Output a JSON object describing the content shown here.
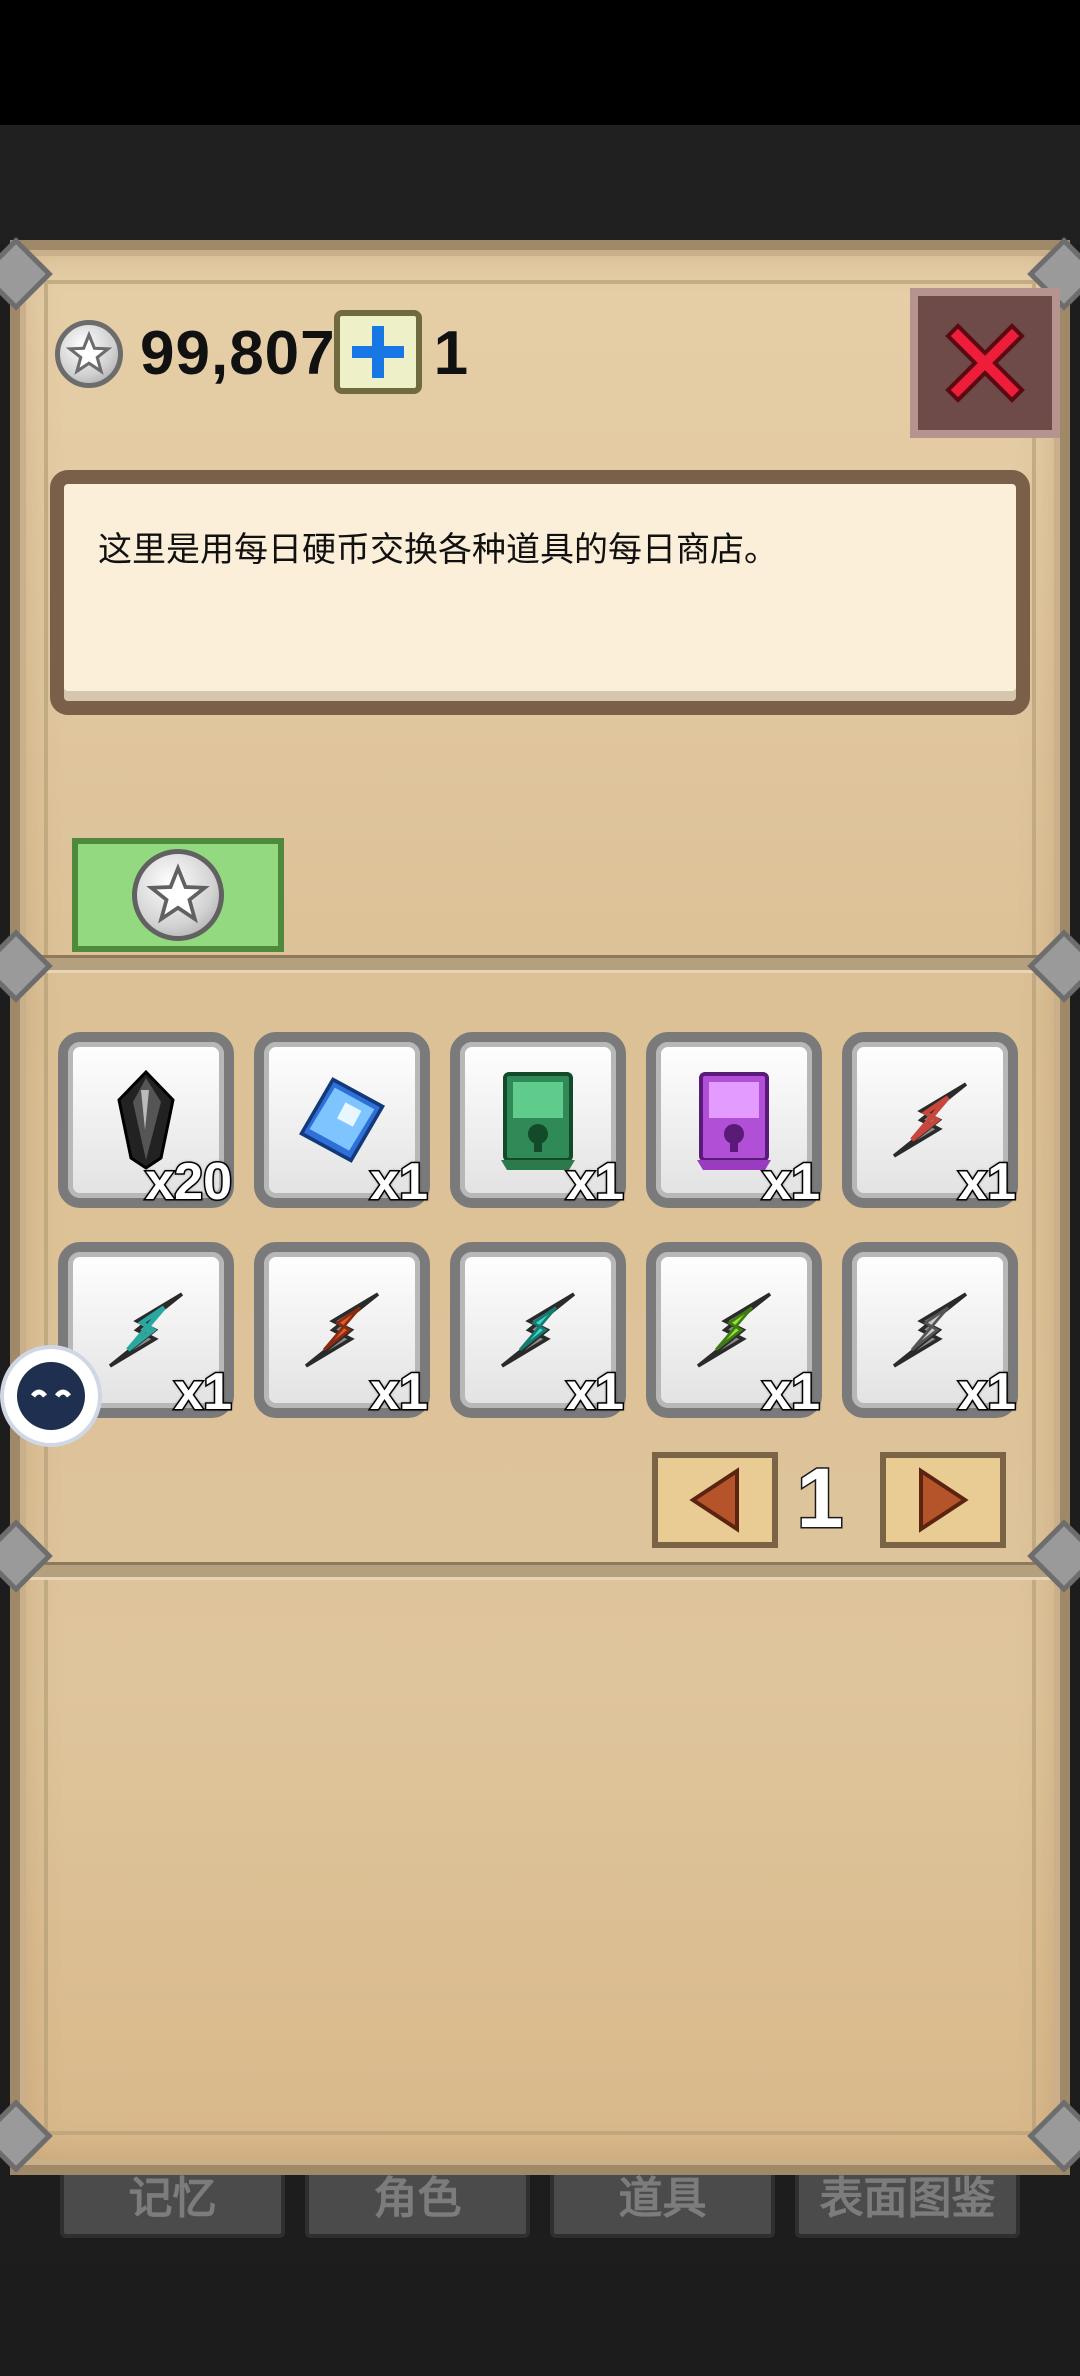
{
  "header": {
    "coin_value": "99,807",
    "coin_suffix": "1",
    "coin_icon": "star-coin-icon",
    "add_icon": "plus-icon",
    "close_icon": "close-x-icon"
  },
  "description": "这里是用每日硬币交换各种道具的每日商店。",
  "category_tab": {
    "icon": "star-coin-icon",
    "selected": true
  },
  "items": [
    {
      "icon": "black-crystal-icon",
      "qty": "x20"
    },
    {
      "icon": "blue-book-icon",
      "qty": "x1"
    },
    {
      "icon": "green-scroll-icon",
      "qty": "x1"
    },
    {
      "icon": "purple-scroll-icon",
      "qty": "x1"
    },
    {
      "icon": "red-lightning-ticket-icon",
      "qty": "x1"
    },
    {
      "icon": "teal-lightning-ticket-icon",
      "qty": "x1"
    },
    {
      "icon": "orange-lightning-ticket-icon",
      "qty": "x1"
    },
    {
      "icon": "cyan-lightning-ticket-icon",
      "qty": "x1"
    },
    {
      "icon": "green-lightning-ticket-icon",
      "qty": "x1"
    },
    {
      "icon": "gray-lightning-ticket-icon",
      "qty": "x1"
    }
  ],
  "pagination": {
    "current_page": "1",
    "prev_icon": "arrow-left-icon",
    "next_icon": "arrow-right-icon"
  },
  "background_tabs": [
    "记忆",
    "角色",
    "道具",
    "表面图鉴"
  ],
  "colors": {
    "panel": "#dcc096",
    "tab_green": "#93d980",
    "close_red": "#e8203a"
  }
}
